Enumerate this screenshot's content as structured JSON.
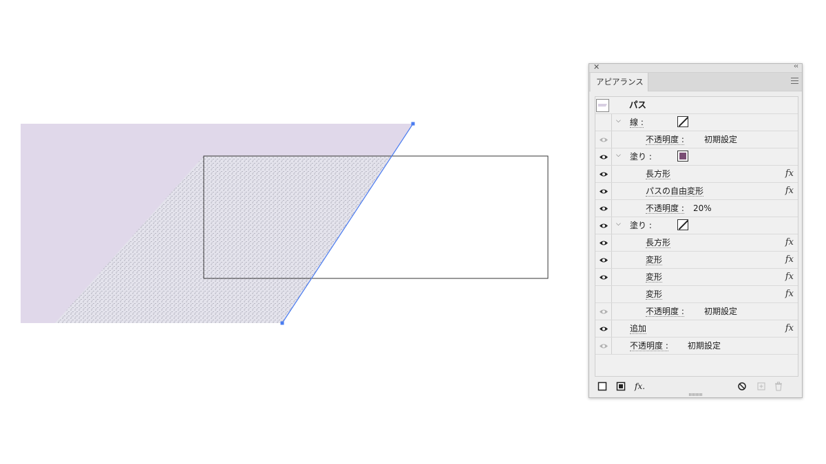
{
  "panel": {
    "tab_label": "アピアランス",
    "object_name": "パス",
    "rows": [
      {
        "kind": "stroke",
        "label": "線 :",
        "eye": "none"
      },
      {
        "kind": "opacity",
        "label": "不透明度 :",
        "value": "初期設定",
        "eye": "faded"
      },
      {
        "kind": "fill",
        "label": "塗り :",
        "eye": "on",
        "swatch_color": "#7a4d74"
      },
      {
        "kind": "effect",
        "label": "長方形",
        "eye": "on",
        "fx": "fx"
      },
      {
        "kind": "effect",
        "label": "パスの自由変形",
        "eye": "on",
        "fx": "fx"
      },
      {
        "kind": "opacity",
        "label": "不透明度 :",
        "value": "20%",
        "eye": "on"
      },
      {
        "kind": "fill",
        "label": "塗り :",
        "eye": "on",
        "swatch_color": "none"
      },
      {
        "kind": "effect",
        "label": "長方形",
        "eye": "on",
        "fx": "fx"
      },
      {
        "kind": "effect",
        "label": "変形",
        "eye": "on",
        "fx": "fx"
      },
      {
        "kind": "effect",
        "label": "変形",
        "eye": "on",
        "fx": "fx"
      },
      {
        "kind": "effect",
        "label": "変形",
        "eye": "none",
        "fx": "fx"
      },
      {
        "kind": "opacity",
        "label": "不透明度 :",
        "value": "初期設定",
        "eye": "faded"
      },
      {
        "kind": "effect-top",
        "label": "追加",
        "eye": "on",
        "fx": "fx"
      },
      {
        "kind": "opacity-top",
        "label": "不透明度 :",
        "value": "初期設定",
        "eye": "faded"
      }
    ],
    "bottom_tools": {
      "fx_label": "fx."
    }
  },
  "canvas": {
    "purple_color": "#e0d8ea",
    "stipple_color": "#e4e3ec",
    "selection_color": "#4a7cf0"
  }
}
